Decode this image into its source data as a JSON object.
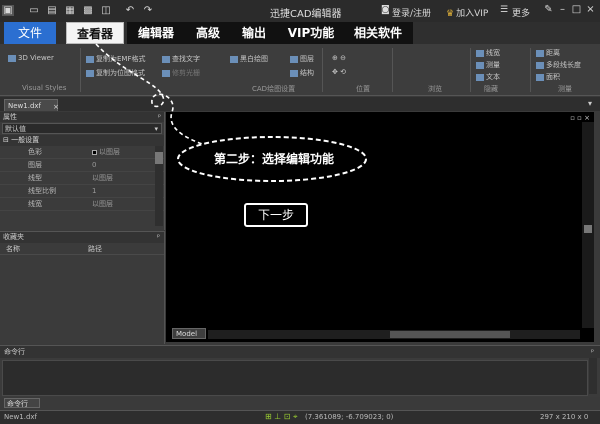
{
  "app": {
    "title": "迅捷CAD编辑器",
    "login_label": "登录/注册",
    "vip_label": "加入VIP",
    "more_label": "更多"
  },
  "tabs": [
    "文件",
    "查看器",
    "编辑器",
    "高级",
    "输出",
    "VIP功能",
    "相关软件"
  ],
  "ribbon": {
    "buttons": [
      "3D Viewer",
      "复制为EMF格式",
      "复制为位图格式",
      "查找文字",
      "修剪光栅",
      "黑白绘图",
      "图层",
      "结构",
      "测量",
      "线宽",
      "文本",
      "距离",
      "多段线长度",
      "面积"
    ],
    "groups": [
      "Visual Styles",
      "CAD绘图设置",
      "位置",
      "浏览",
      "隐藏",
      "测量"
    ]
  },
  "document": {
    "tab_label": "New1.dxf",
    "close_glyph": "×"
  },
  "properties": {
    "header": "属性",
    "pin_glyph": "ᵖ",
    "selector_value": "默认值",
    "section": "⊟ 一般设置",
    "rows": [
      {
        "key": "色彩",
        "value": "以图层"
      },
      {
        "key": "图层",
        "value": "0"
      },
      {
        "key": "线型",
        "value": "以图层"
      },
      {
        "key": "线型比例",
        "value": "1"
      },
      {
        "key": "线宽",
        "value": "以图层"
      }
    ]
  },
  "favorites": {
    "header": "收藏夹",
    "col_name": "名称",
    "col_path": "路径"
  },
  "canvas": {
    "window_controls": "▫ ▫ ×",
    "model_tab": "Model"
  },
  "command": {
    "header": "命令行",
    "tab_label": "命令行"
  },
  "status": {
    "file": "New1.dxf",
    "coords": "(7.361089; -6.709023; 0)",
    "size": "297 x 210 x 0"
  },
  "overlay": {
    "step_text": "第二步：选择编辑功能",
    "next_label": "下一步",
    "colors": {
      "highlight": "#2b6fd1",
      "bubble_border": "#ffffff"
    }
  }
}
